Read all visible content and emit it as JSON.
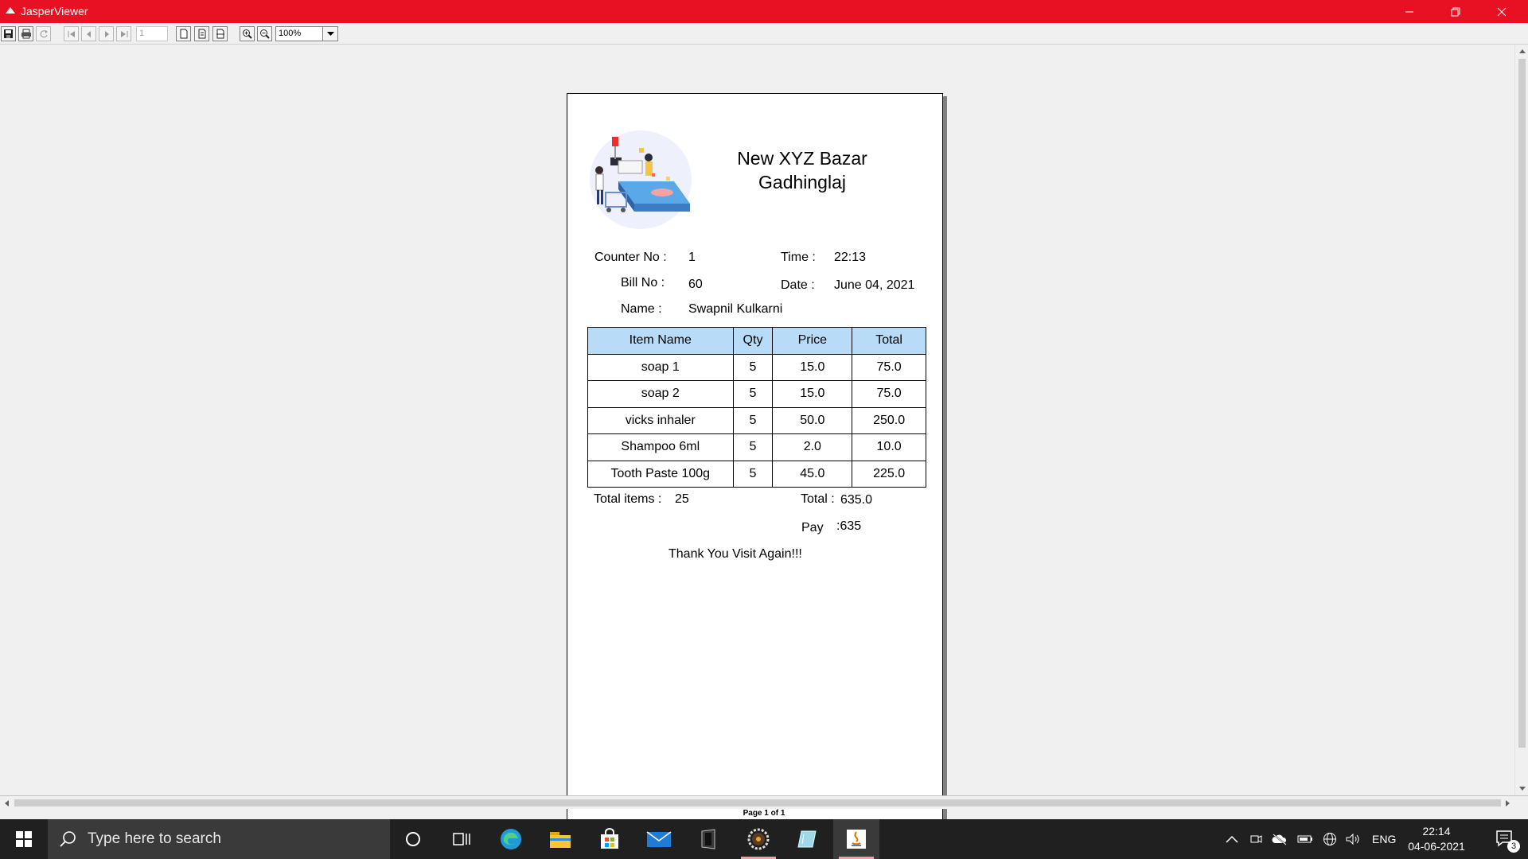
{
  "window": {
    "title": "JasperViewer"
  },
  "toolbar": {
    "page_number": "1",
    "zoom": "100%"
  },
  "report": {
    "store_name": "New XYZ Bazar",
    "store_city": "Gadhinglaj",
    "counter_label": "Counter No :",
    "counter_value": "1",
    "time_label": "Time :",
    "time_value": "22:13",
    "bill_label": "Bill No  :",
    "bill_value": "60",
    "date_label": "Date :",
    "date_value": "June 04, 2021",
    "name_label": "Name :",
    "name_value": "Swapnil Kulkarni",
    "columns": [
      "Item Name",
      "Qty",
      "Price",
      "Total"
    ],
    "rows": [
      [
        "soap 1",
        "5",
        "15.0",
        "75.0"
      ],
      [
        "soap 2",
        "5",
        "15.0",
        "75.0"
      ],
      [
        "vicks inhaler",
        "5",
        "50.0",
        "250.0"
      ],
      [
        "Shampoo 6ml",
        "5",
        "2.0",
        "10.0"
      ],
      [
        "Tooth Paste 100g",
        "5",
        "45.0",
        "225.0"
      ]
    ],
    "total_items_label": "Total items :",
    "total_items_value": "25",
    "total_label": "Total :",
    "total_value": "635.0",
    "pay_label": "Pay",
    "pay_value": ":635",
    "thanks": "Thank You Visit Again!!!"
  },
  "status": {
    "page_info": "Page 1 of 1"
  },
  "taskbar": {
    "search_placeholder": "Type here to search",
    "language": "ENG",
    "time": "22:14",
    "date": "04-06-2021",
    "notification_count": "3"
  },
  "colors": {
    "title_bar": "#e81123",
    "table_header": "#b8dcf8",
    "taskbar": "#202020"
  }
}
